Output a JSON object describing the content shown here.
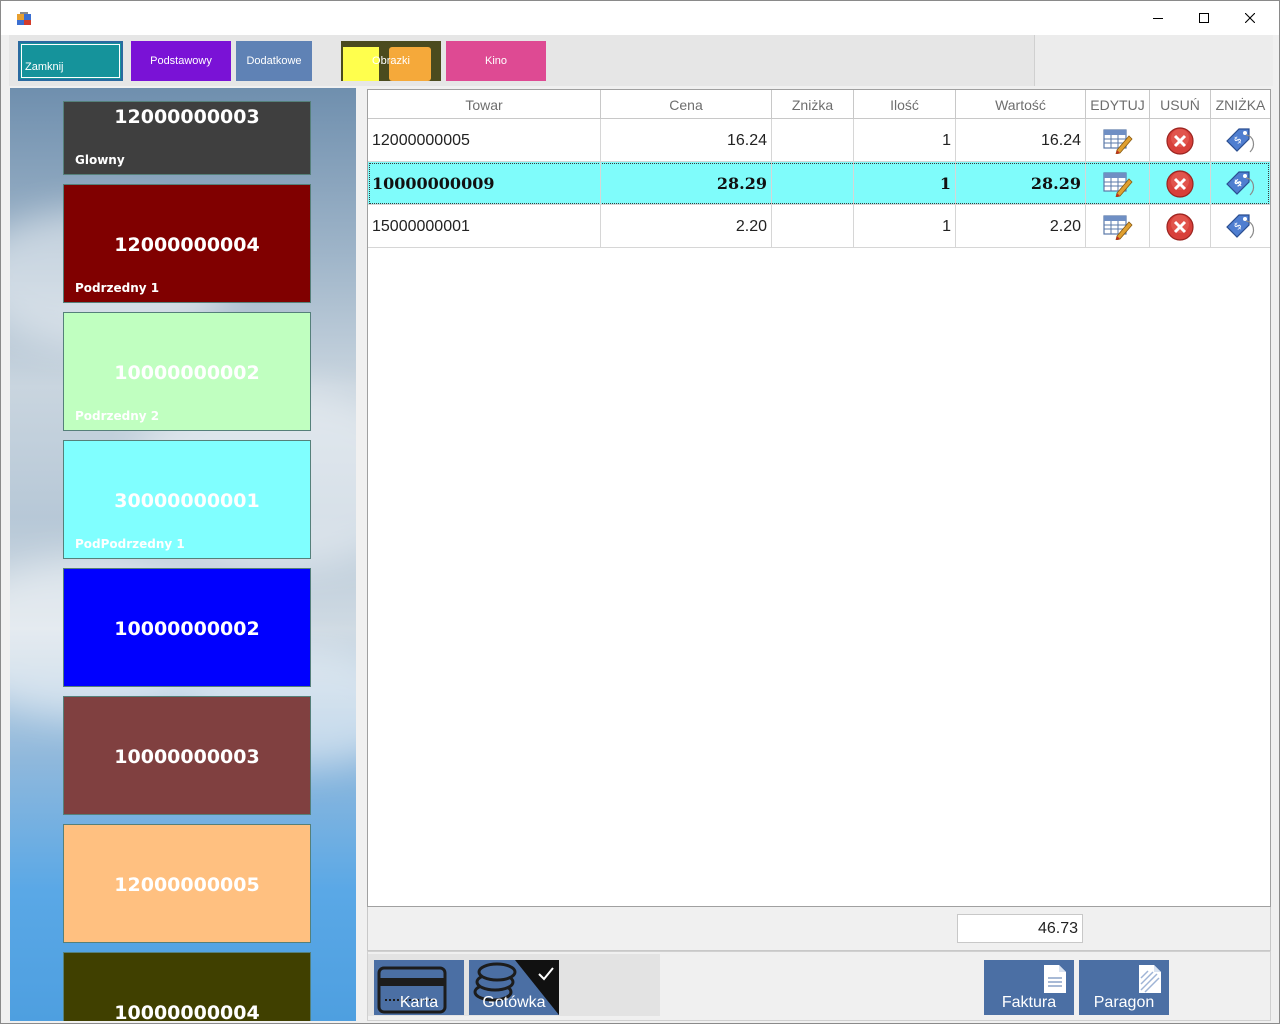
{
  "window": {
    "controls": [
      "minimize",
      "maximize",
      "close"
    ]
  },
  "categories": [
    {
      "label": "Zamknij",
      "color": "#15939b"
    },
    {
      "label": "Podstawowy",
      "color": "#7a12d6"
    },
    {
      "label": "Dodatkowe",
      "color": "#5f82b5"
    },
    {
      "label": "Obrazki",
      "color": "#4b4b1e"
    },
    {
      "label": "Kino",
      "color": "#de4a93"
    }
  ],
  "products": [
    {
      "code": "12000000003",
      "group": "Glowny",
      "color": "#3f3f3f"
    },
    {
      "code": "12000000004",
      "group": "Podrzedny 1",
      "color": "#800000"
    },
    {
      "code": "10000000002",
      "group": "Podrzedny 2",
      "color": "#c0ffc0"
    },
    {
      "code": "30000000001",
      "group": "PodPodrzedny 1",
      "color": "#80ffff"
    },
    {
      "code": "10000000002",
      "group": "",
      "color": "#0000ff"
    },
    {
      "code": "10000000003",
      "group": "",
      "color": "#804040"
    },
    {
      "code": "12000000005",
      "group": "",
      "color": "#ffc080"
    },
    {
      "code": "10000000004",
      "group": "",
      "color": "#404000"
    }
  ],
  "grid": {
    "columns": [
      "Towar",
      "Cena",
      "Zniżka",
      "Ilość",
      "Wartość",
      "EDYTUJ",
      "USUŃ",
      "ZNIŻKA"
    ],
    "rows": [
      {
        "towar": "12000000005",
        "cena": "16.24",
        "znizka": "",
        "ilosc": "1",
        "wartosc": "16.24",
        "selected": false
      },
      {
        "towar": "10000000009",
        "cena": "28.29",
        "znizka": "",
        "ilosc": "1",
        "wartosc": "28.29",
        "selected": true
      },
      {
        "towar": "15000000001",
        "cena": "2.20",
        "znizka": "",
        "ilosc": "1",
        "wartosc": "2.20",
        "selected": false
      }
    ],
    "row_icons": {
      "edit": "edit-grid-icon",
      "delete": "delete-x-icon",
      "discount": "price-tag-icon"
    }
  },
  "summary": {
    "total": "46.73"
  },
  "payment": {
    "card_label": "Karta",
    "cash_label": "Gotówka",
    "cash_selected": true
  },
  "documents": {
    "invoice_label": "Faktura",
    "receipt_label": "Paragon"
  },
  "colors": {
    "selected_row": "#7ffcfb",
    "action_button": "#4b6fa4"
  }
}
